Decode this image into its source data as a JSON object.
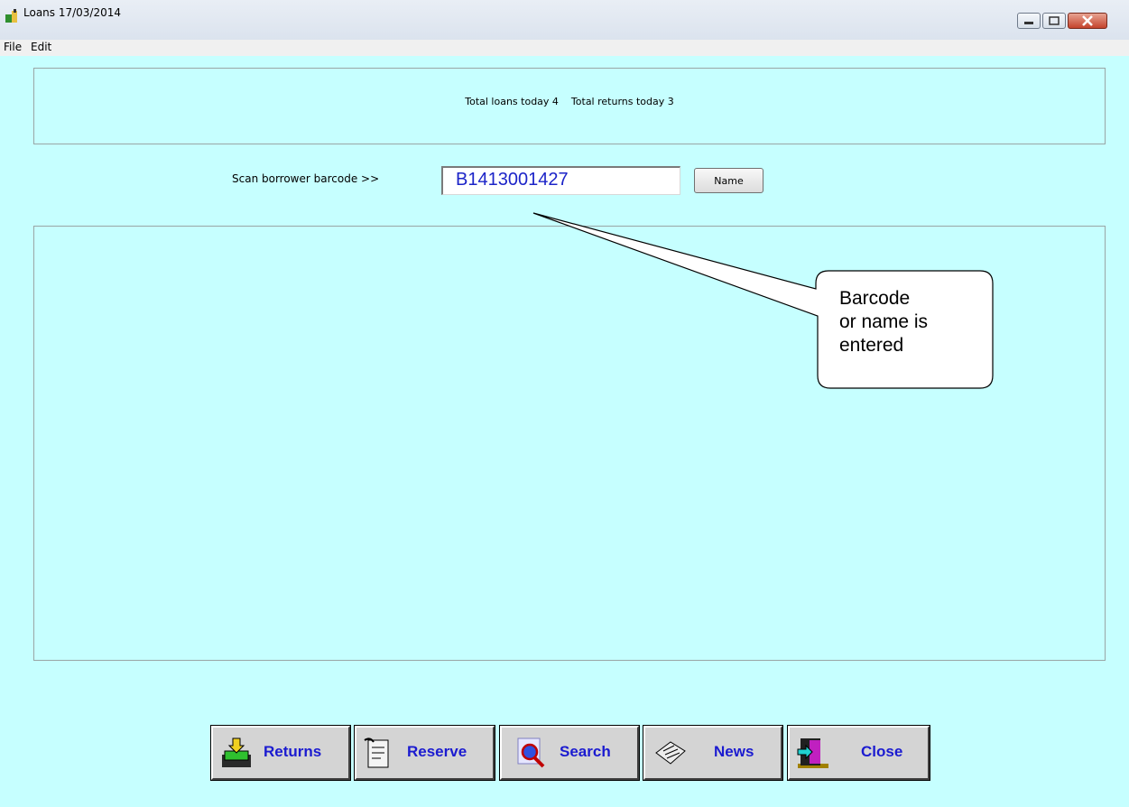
{
  "window": {
    "title": "Loans 17/03/2014"
  },
  "menu": {
    "items": [
      "File",
      "Edit"
    ]
  },
  "stats": {
    "loans": "Total loans today 4",
    "returns": "Total returns today 3"
  },
  "scan": {
    "label": "Scan borrower barcode >>",
    "value": "B1413001427",
    "name_button": "Name"
  },
  "callout": {
    "lines": [
      "Barcode",
      "or name is",
      "entered"
    ]
  },
  "toolbar": {
    "buttons": [
      "Returns",
      "Reserve",
      "Search",
      "News",
      "Close"
    ]
  },
  "colors": {
    "background": "#c6ffff",
    "input_text": "#1c24c8",
    "button_text": "#1b1bd0"
  }
}
